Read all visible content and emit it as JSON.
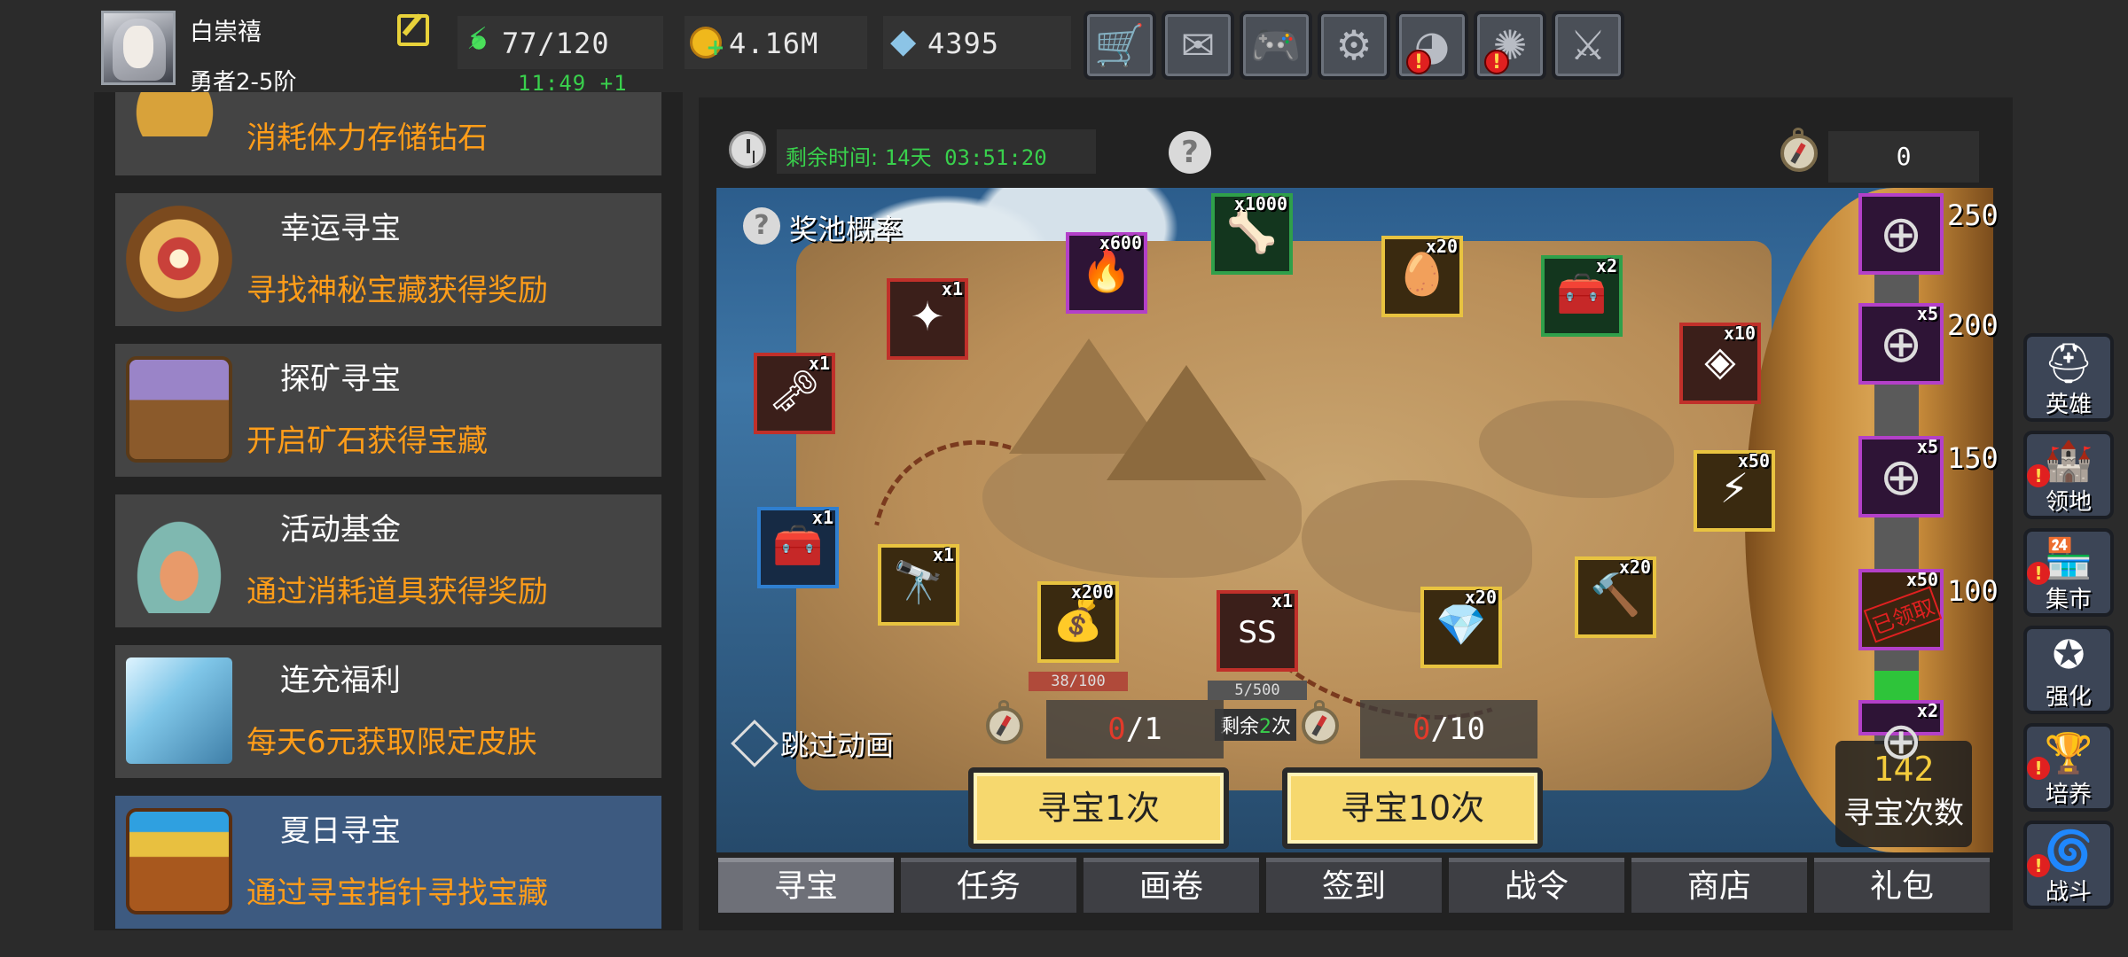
{
  "player": {
    "name": "白崇禧",
    "rank": "勇者2-5阶"
  },
  "resources": {
    "energy": "77/120",
    "energy_timer": "11:49 +1",
    "gold": "4.16M",
    "gems": "4395"
  },
  "top_buttons": [
    {
      "icon": "cart-icon",
      "glyph": "🛒",
      "alert": false
    },
    {
      "icon": "mail-icon",
      "glyph": "✉",
      "alert": false
    },
    {
      "icon": "gamepad-icon",
      "glyph": "🎮",
      "alert": false
    },
    {
      "icon": "gear-icon",
      "glyph": "⚙",
      "alert": false
    },
    {
      "icon": "color-wheel-icon",
      "glyph": "◕",
      "alert": true
    },
    {
      "icon": "fireworks-icon",
      "glyph": "✺",
      "alert": true
    },
    {
      "icon": "crossed-swords-icon",
      "glyph": "⚔",
      "alert": false
    }
  ],
  "events": [
    {
      "title": "",
      "desc": "消耗体力存储钻石"
    },
    {
      "title": "幸运寻宝",
      "desc": "寻找神秘宝藏获得奖励"
    },
    {
      "title": "探矿寻宝",
      "desc": "开启矿石获得宝藏"
    },
    {
      "title": "活动基金",
      "desc": "通过消耗道具获得奖励"
    },
    {
      "title": "连充福利",
      "desc": "每天6元获取限定皮肤"
    },
    {
      "title": "夏日寻宝",
      "desc": "通过寻宝指针寻找宝藏"
    }
  ],
  "hunt": {
    "remaining_label": "剩余时间:",
    "remaining_value": "14天 03:51:20",
    "compass_count": "0",
    "pool_label": "奖池概率",
    "skip_label": "跳过动画",
    "count_one": {
      "used": "0",
      "total": "/1"
    },
    "count_ten": {
      "used": "0",
      "total": "/10"
    },
    "btn_one": "寻宝1次",
    "btn_ten": "寻宝10次",
    "dig_count": "142",
    "dig_label": "寻宝次数",
    "progress_fraction": 0.12
  },
  "map_items": [
    {
      "qty": "x1",
      "glyph": "🗝",
      "style": ""
    },
    {
      "qty": "x1",
      "glyph": "✦",
      "style": ""
    },
    {
      "qty": "x600",
      "glyph": "🔥",
      "style": "purple"
    },
    {
      "qty": "x1000",
      "glyph": "🦴",
      "style": "green"
    },
    {
      "qty": "x20",
      "glyph": "🥚",
      "style": "gold"
    },
    {
      "qty": "x2",
      "glyph": "🧰",
      "style": "green"
    },
    {
      "qty": "x10",
      "glyph": "◈",
      "style": ""
    },
    {
      "qty": "x1",
      "glyph": "🧰",
      "style": "blue"
    },
    {
      "qty": "x1",
      "glyph": "🔭",
      "style": "gold"
    },
    {
      "qty": "x200",
      "glyph": "💰",
      "style": "gold",
      "progress": "38/100"
    },
    {
      "qty": "x1",
      "glyph": "SS",
      "style": "",
      "progress": "5/500"
    },
    {
      "qty": "x20",
      "glyph": "💎",
      "style": "gold"
    },
    {
      "qty": "x20",
      "glyph": "🔨",
      "style": "gold"
    },
    {
      "qty": "x50",
      "glyph": "⚡",
      "style": "gold"
    }
  ],
  "remain_times": {
    "prefix": "剩余",
    "num": "2",
    "suffix": "次"
  },
  "milestones": [
    {
      "qty": "",
      "label": "250",
      "claimed": false
    },
    {
      "qty": "x5",
      "label": "200",
      "claimed": false
    },
    {
      "qty": "x5",
      "label": "150",
      "claimed": false
    },
    {
      "qty": "x50",
      "label": "100",
      "claimed": true,
      "stamp": "已领取"
    },
    {
      "qty": "x2",
      "label": "",
      "claimed": false
    }
  ],
  "tabs": [
    "寻宝",
    "任务",
    "画卷",
    "签到",
    "战令",
    "商店",
    "礼包"
  ],
  "active_tab": 0,
  "side_buttons": [
    {
      "label": "英雄",
      "glyph": "⛑",
      "alert": false
    },
    {
      "label": "领地",
      "glyph": "🏰",
      "alert": true
    },
    {
      "label": "集市",
      "glyph": "🏪",
      "alert": true
    },
    {
      "label": "强化",
      "glyph": "✪",
      "alert": false
    },
    {
      "label": "培养",
      "glyph": "🏆",
      "alert": true
    },
    {
      "label": "战斗",
      "glyph": "🌀",
      "alert": true
    }
  ],
  "colors": {
    "accent_orange": "#ff9d19",
    "timer_green": "#39d04c",
    "selected_event": "#3d5a80",
    "button_yellow": "#f6d86e"
  }
}
